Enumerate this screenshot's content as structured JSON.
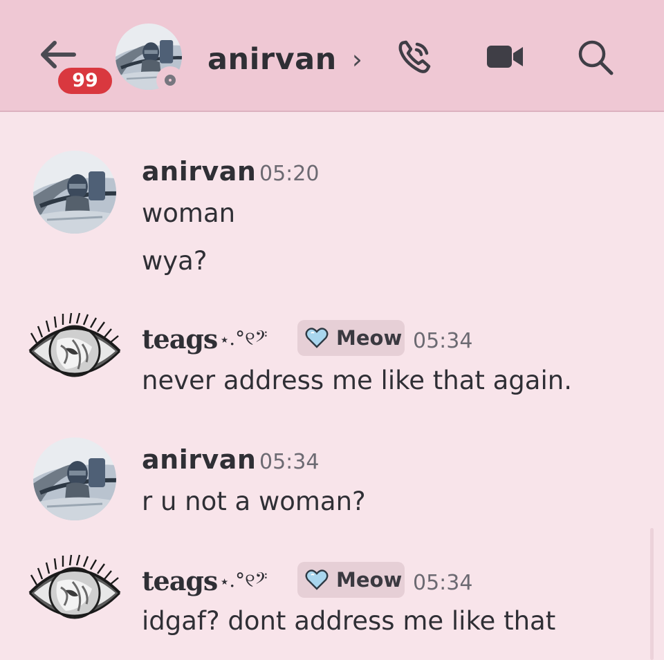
{
  "header": {
    "back_icon": "arrow-left-icon",
    "unread_count": "99",
    "title": "anirvan",
    "chevron": "›",
    "call_icon": "phone-call-icon",
    "video_icon": "video-camera-icon",
    "search_icon": "search-icon"
  },
  "messages": [
    {
      "author": "anirvan",
      "time": "05:20",
      "lines": [
        "woman",
        "wya?"
      ]
    },
    {
      "author": "teags",
      "decoration": "⋆.°୧𝄢",
      "role": "Meow",
      "time": "05:34",
      "lines": [
        "never address me like that again."
      ]
    },
    {
      "author": "anirvan",
      "time": "05:34",
      "lines": [
        "r u not a woman?"
      ]
    },
    {
      "author": "teags",
      "decoration": "⋆.°୧𝄢",
      "role": "Meow",
      "time": "05:34",
      "lines": [
        "idgaf? dont address me like that"
      ]
    }
  ],
  "colors": {
    "header_bg": "#efc8d4",
    "chat_bg": "#f8e4ea",
    "badge_red": "#d9383f",
    "role_tag_bg": "#e6cfd6",
    "heart_blue": "#a9d6ee"
  }
}
